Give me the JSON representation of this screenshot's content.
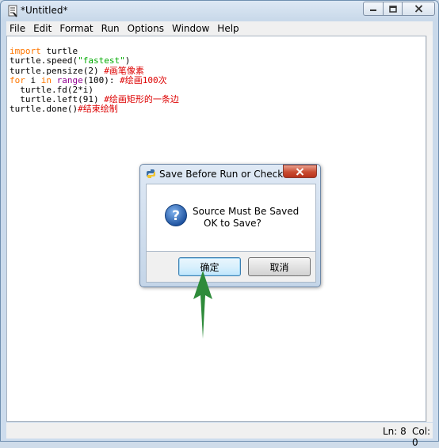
{
  "window": {
    "title": "*Untitled*"
  },
  "menu": [
    "File",
    "Edit",
    "Format",
    "Run",
    "Options",
    "Window",
    "Help"
  ],
  "code": {
    "l1_kw": "import",
    "l1_rest": " turtle",
    "l2_a": "turtle.speed(",
    "l2_str": "\"fastest\"",
    "l2_b": ")",
    "l3_code": "turtle.pensize(2) ",
    "l3_comment": "#画笔像素",
    "l4_for": "for",
    "l4_i": " i ",
    "l4_in": "in",
    "l4_sp": " ",
    "l4_range": "range",
    "l4_rest": "(100): ",
    "l4_comment": "#绘画100次",
    "l5": "  turtle.fd(2*i)",
    "l6_code": "  turtle.left(91) ",
    "l6_comment": "#绘画矩形的一条边",
    "l7_code": "turtle.done()",
    "l7_comment": "#结束绘制"
  },
  "status": {
    "line": "Ln: 8",
    "col": "Col: 0"
  },
  "dialog": {
    "title": "Save Before Run or Check",
    "message_line1": "Source Must Be Saved",
    "message_line2": "OK to Save?",
    "ok_label": "确定",
    "cancel_label": "取消"
  },
  "colors": {
    "keyword": "#ff7700",
    "builtin": "#900090",
    "string": "#00aa00",
    "comment": "#dd0000",
    "arrow": "#2e8b3a"
  },
  "icons": [
    "idle-app-icon",
    "minimize-icon",
    "maximize-icon",
    "close-icon",
    "python-icon",
    "question-icon",
    "green-arrow-annotation"
  ]
}
